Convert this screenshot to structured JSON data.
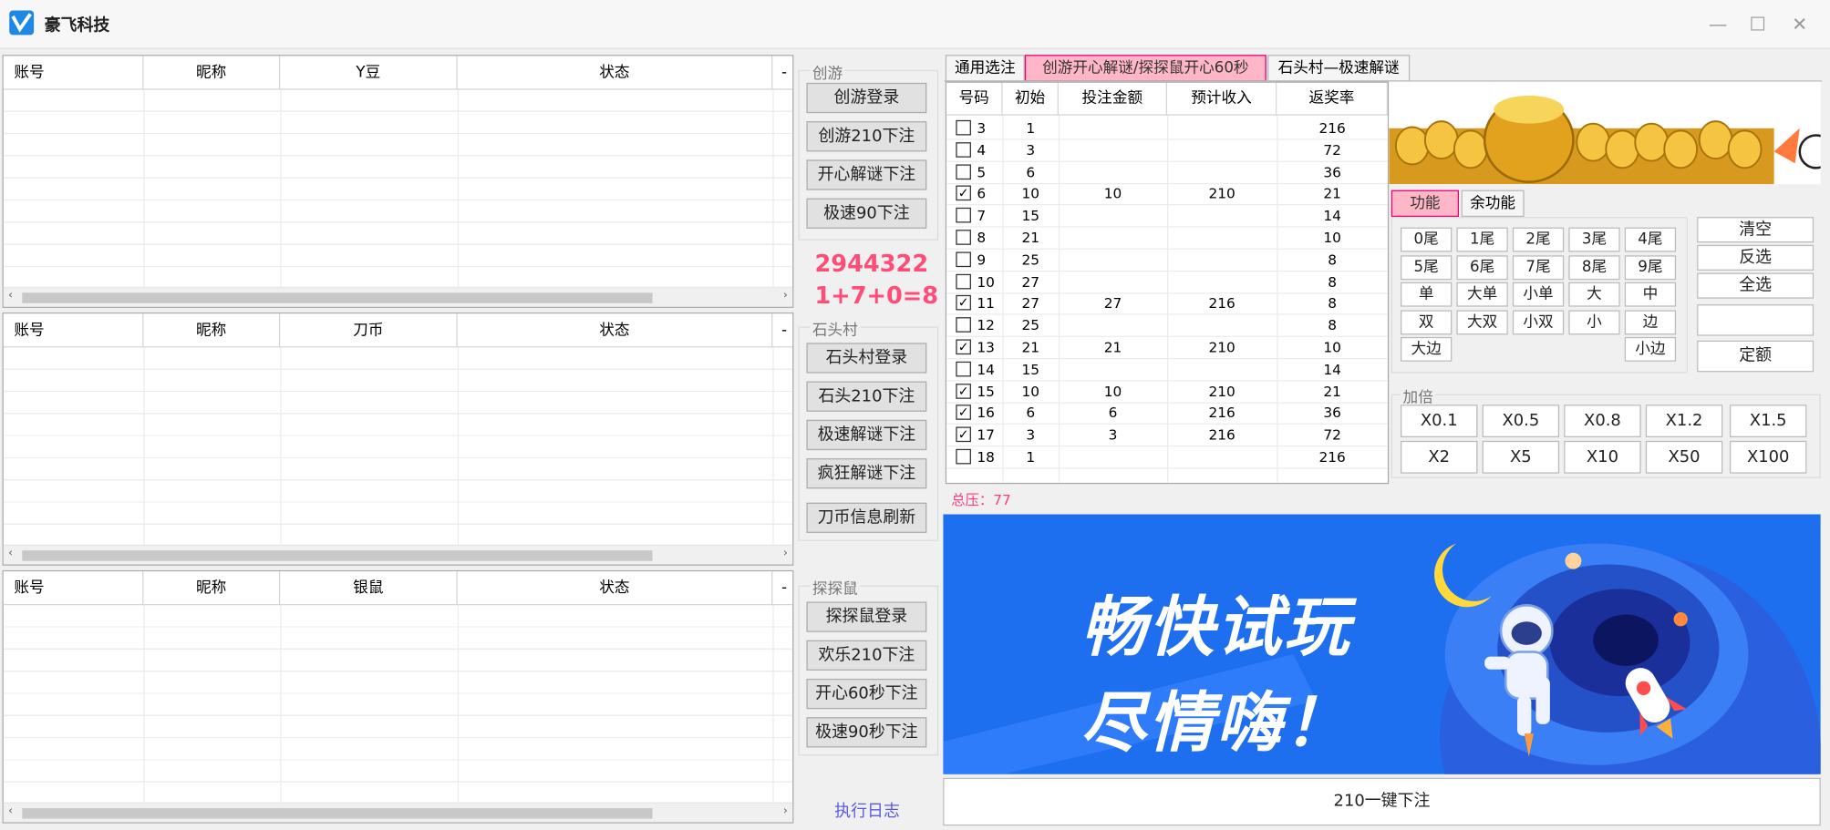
{
  "window": {
    "title": "豪飞科技",
    "min_icon": "minimize-icon",
    "max_icon": "maximize-icon",
    "close_icon": "close-icon"
  },
  "grids": [
    {
      "columns": [
        "账号",
        "昵称",
        "Y豆",
        "状态",
        "-"
      ]
    },
    {
      "columns": [
        "账号",
        "昵称",
        "刀币",
        "状态",
        "-"
      ]
    },
    {
      "columns": [
        "账号",
        "昵称",
        "银鼠",
        "状态",
        "-"
      ]
    }
  ],
  "chuangyou": {
    "title": "创游",
    "buttons": [
      "创游登录",
      "创游210下注",
      "开心解谜下注",
      "极速90下注"
    ]
  },
  "result": {
    "number": "2944322",
    "sum": "1+7+0=8"
  },
  "shitoucun": {
    "title": "石头村",
    "buttons": [
      "石头村登录",
      "石头210下注",
      "极速解谜下注",
      "疯狂解谜下注",
      "刀币信息刷新"
    ]
  },
  "tantanshu": {
    "title": "探探鼠",
    "buttons": [
      "探探鼠登录",
      "欢乐210下注",
      "开心60秒下注",
      "极速90秒下注"
    ]
  },
  "log_link": "执行日志",
  "tabs": [
    "通用选注",
    "创游开心解谜/探探鼠开心60秒",
    "石头村—极速解谜"
  ],
  "bet_table": {
    "columns": [
      "号码",
      "初始",
      "投注金额",
      "预计收入",
      "返奖率"
    ],
    "rows": [
      {
        "num": "3",
        "init": "1",
        "amount": "",
        "income": "",
        "rate": "216",
        "checked": false
      },
      {
        "num": "4",
        "init": "3",
        "amount": "",
        "income": "",
        "rate": "72",
        "checked": false
      },
      {
        "num": "5",
        "init": "6",
        "amount": "",
        "income": "",
        "rate": "36",
        "checked": false
      },
      {
        "num": "6",
        "init": "10",
        "amount": "10",
        "income": "210",
        "rate": "21",
        "checked": true
      },
      {
        "num": "7",
        "init": "15",
        "amount": "",
        "income": "",
        "rate": "14",
        "checked": false
      },
      {
        "num": "8",
        "init": "21",
        "amount": "",
        "income": "",
        "rate": "10",
        "checked": false
      },
      {
        "num": "9",
        "init": "25",
        "amount": "",
        "income": "",
        "rate": "8",
        "checked": false
      },
      {
        "num": "10",
        "init": "27",
        "amount": "",
        "income": "",
        "rate": "8",
        "checked": false
      },
      {
        "num": "11",
        "init": "27",
        "amount": "27",
        "income": "216",
        "rate": "8",
        "checked": true
      },
      {
        "num": "12",
        "init": "25",
        "amount": "",
        "income": "",
        "rate": "8",
        "checked": false
      },
      {
        "num": "13",
        "init": "21",
        "amount": "21",
        "income": "210",
        "rate": "10",
        "checked": true
      },
      {
        "num": "14",
        "init": "15",
        "amount": "",
        "income": "",
        "rate": "14",
        "checked": false
      },
      {
        "num": "15",
        "init": "10",
        "amount": "10",
        "income": "210",
        "rate": "21",
        "checked": true
      },
      {
        "num": "16",
        "init": "6",
        "amount": "6",
        "income": "216",
        "rate": "36",
        "checked": true
      },
      {
        "num": "17",
        "init": "3",
        "amount": "3",
        "income": "216",
        "rate": "72",
        "checked": true
      },
      {
        "num": "18",
        "init": "1",
        "amount": "",
        "income": "",
        "rate": "216",
        "checked": false
      }
    ]
  },
  "total": "总压：77",
  "func_tabs": [
    "功能",
    "余功能"
  ],
  "func_buttons": [
    [
      "0尾",
      "1尾",
      "2尾",
      "3尾",
      "4尾"
    ],
    [
      "5尾",
      "6尾",
      "7尾",
      "8尾",
      "9尾"
    ],
    [
      "单",
      "大单",
      "小单",
      "大",
      "中"
    ],
    [
      "双",
      "大双",
      "小双",
      "小",
      "边"
    ],
    [
      "大边",
      "",
      "",
      "",
      "小边"
    ]
  ],
  "right_buttons": [
    "清空",
    "反选",
    "全选",
    "",
    "定额"
  ],
  "multiplier": {
    "title": "加倍",
    "buttons": [
      [
        "X0.1",
        "X0.5",
        "X0.8",
        "X1.2",
        "X1.5"
      ],
      [
        "X2",
        "X5",
        "X10",
        "X50",
        "X100"
      ]
    ]
  },
  "banner": {
    "line1": "畅快试玩",
    "line2": "尽情嗨！"
  },
  "one_click_bet": "210一键下注",
  "colors": {
    "accent_pink": "#ff4d7a",
    "tab_active": "#ffb6c6",
    "banner_blue": "#1d6ff0"
  }
}
